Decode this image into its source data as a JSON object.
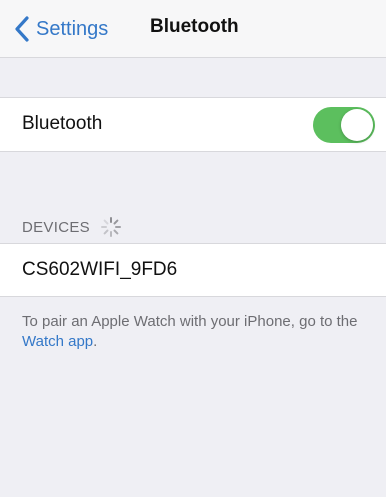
{
  "navbar": {
    "back_label": "Settings",
    "title": "Bluetooth",
    "back_icon": "chevron-left-icon",
    "accent_color": "#3478c8"
  },
  "bluetooth_row": {
    "label": "Bluetooth",
    "toggle_on": true,
    "toggle_color": "#5cbf5e"
  },
  "devices_section": {
    "header": "DEVICES",
    "spinner_icon": "activity-spinner-icon",
    "devices": [
      {
        "name": "CS602WIFI_9FD6"
      }
    ]
  },
  "footer": {
    "text_before": "To pair an Apple Watch with your iPhone, go to the ",
    "link_text": "Watch app",
    "text_after": "."
  }
}
